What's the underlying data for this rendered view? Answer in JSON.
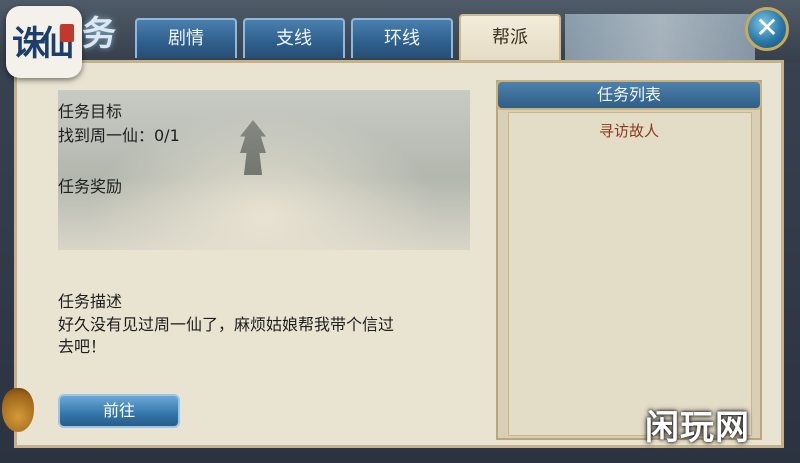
{
  "logo": {
    "text": "诛仙"
  },
  "header": {
    "title_glyph": "务"
  },
  "tabs": [
    {
      "label": "剧情"
    },
    {
      "label": "支线"
    },
    {
      "label": "环线"
    },
    {
      "label": "帮派",
      "active": true
    }
  ],
  "quest": {
    "objective_heading": "任务目标",
    "objective_text": "找到周一仙：0/1",
    "reward_heading": "任务奖励",
    "description_heading": "任务描述",
    "description_line1": "好久没有见过周一仙了，麻烦姑娘帮我带个信过",
    "description_line2": "去吧！"
  },
  "task_list": {
    "header": "任务列表",
    "items": [
      {
        "label": "寻访故人"
      }
    ]
  },
  "go_button": {
    "label": "前往"
  },
  "watermark": {
    "text": "闲玩网"
  },
  "colors": {
    "accent_blue": "#2f5e87",
    "parchment": "#e9e3d2",
    "list_item": "#8a3a1a"
  }
}
